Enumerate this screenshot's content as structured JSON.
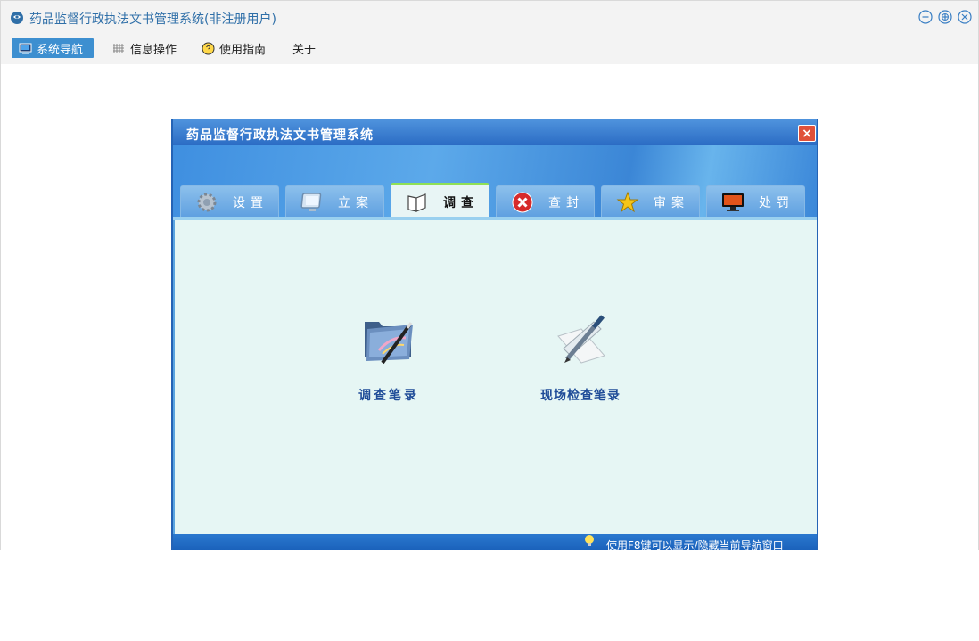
{
  "window": {
    "title": "药品监督行政执法文书管理系统(非注册用户)"
  },
  "menubar": {
    "items": [
      {
        "label": "系统导航",
        "icon": "monitor-icon",
        "active": true
      },
      {
        "label": "信息操作",
        "icon": "grid-icon",
        "active": false
      },
      {
        "label": "使用指南",
        "icon": "help-icon",
        "active": false
      },
      {
        "label": "关于",
        "icon": "",
        "active": false
      }
    ]
  },
  "dialog": {
    "title": "药品监督行政执法文书管理系统",
    "close_label": "×",
    "tabs": [
      {
        "label": "设置",
        "icon": "gear-icon",
        "active": false
      },
      {
        "label": "立案",
        "icon": "monitor-icon",
        "active": false
      },
      {
        "label": "调查",
        "icon": "book-icon",
        "active": true
      },
      {
        "label": "查封",
        "icon": "red-x-icon",
        "active": false
      },
      {
        "label": "审案",
        "icon": "star-icon",
        "active": false
      },
      {
        "label": "处罚",
        "icon": "display-icon",
        "active": false
      }
    ],
    "tools": [
      {
        "label": "调查笔录",
        "icon": "folder-pen-icon"
      },
      {
        "label": "现场检查笔录",
        "icon": "pen-ruler-icon"
      }
    ],
    "status_text": "使用F8键可以显示/隐藏当前导航窗口"
  },
  "colors": {
    "accent": "#3d8fd0",
    "dialog_title": "#2b6cc4",
    "body_bg": "#e6f6f4",
    "active_tab_border": "#8fe055"
  }
}
